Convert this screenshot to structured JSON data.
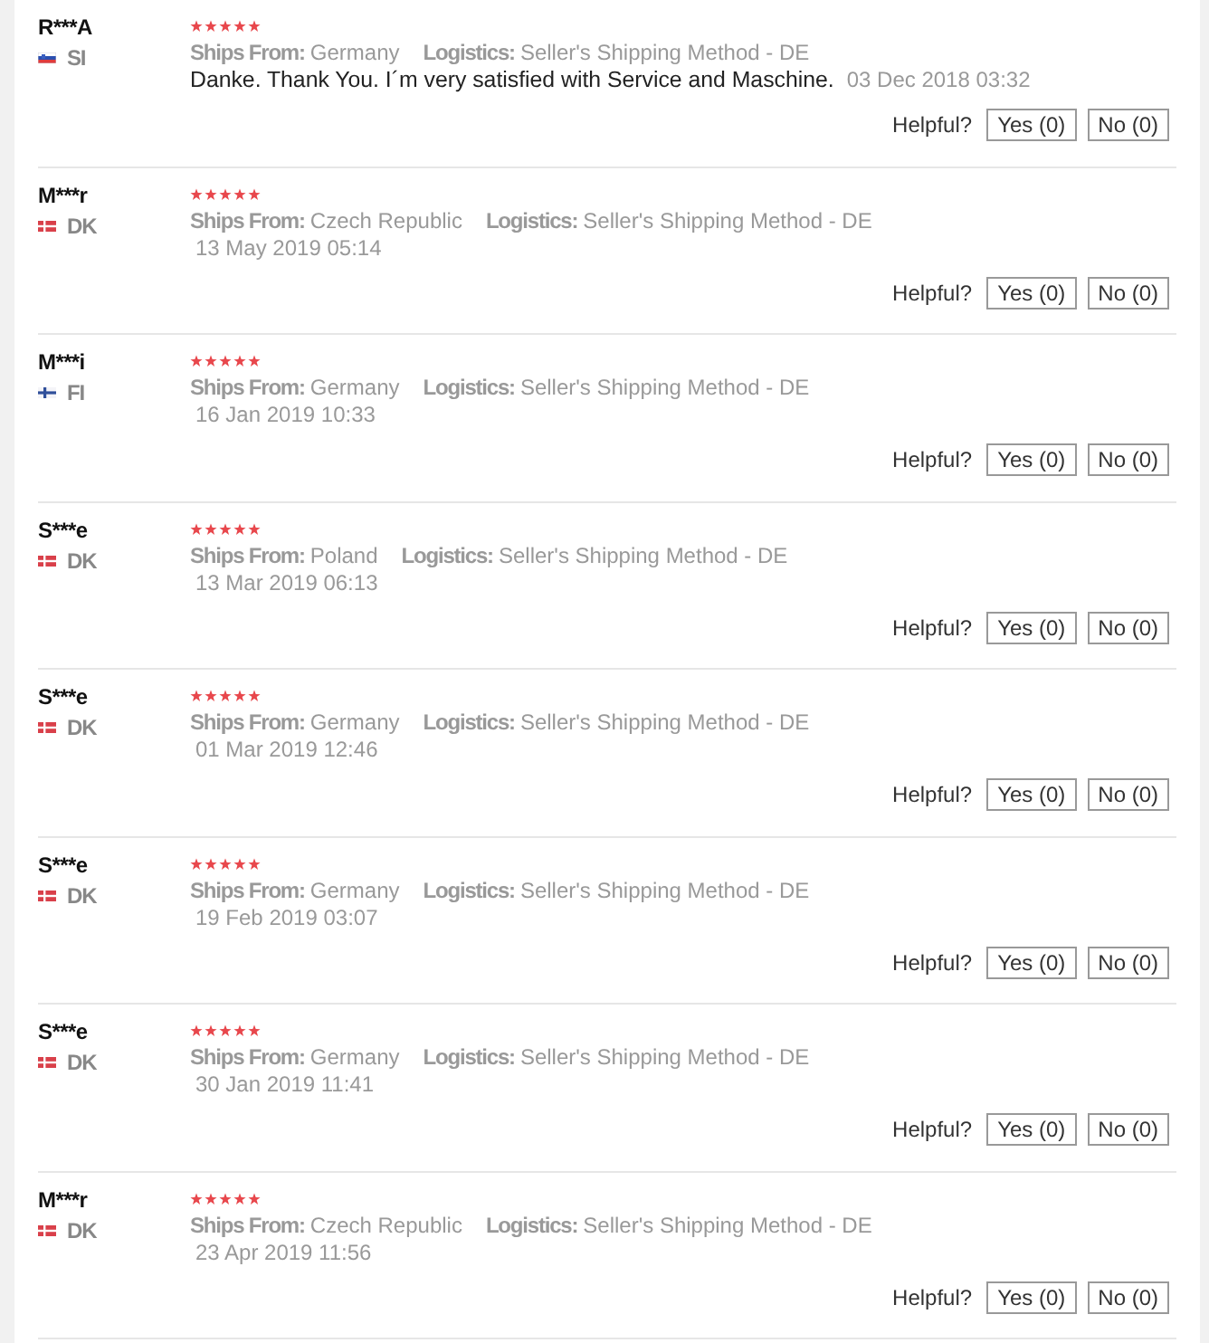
{
  "reviews": [
    {
      "name": "R***A",
      "flag": {
        "kind": "slovenia"
      },
      "country": "SI",
      "stars": 5,
      "ships_from_label": "Ships From:",
      "ships_from": "Germany",
      "logistics_label": "Logistics:",
      "logistics": "Seller's Shipping Method - DE",
      "text": "Danke. Thank You. I´m very satisfied with Service and Maschine.",
      "date": "03 Dec 2018 03:32",
      "helpful_label": "Helpful?",
      "yes_button": "Yes (0)",
      "no_button": "No (0)"
    },
    {
      "name": "M***r",
      "flag": {
        "kind": "denmark"
      },
      "country": "DK",
      "stars": 5,
      "ships_from_label": "Ships From:",
      "ships_from": "Czech Republic",
      "logistics_label": "Logistics:",
      "logistics": "Seller's Shipping Method - DE",
      "date": "13 May 2019 05:14",
      "helpful_label": "Helpful?",
      "yes_button": "Yes (0)",
      "no_button": "No (0)"
    },
    {
      "name": "M***i",
      "flag": {
        "kind": "finland"
      },
      "country": "FI",
      "stars": 5,
      "ships_from_label": "Ships From:",
      "ships_from": "Germany",
      "logistics_label": "Logistics:",
      "logistics": "Seller's Shipping Method - DE",
      "date": "16 Jan 2019 10:33",
      "helpful_label": "Helpful?",
      "yes_button": "Yes (0)",
      "no_button": "No (0)"
    },
    {
      "name": "S***e",
      "flag": {
        "kind": "denmark"
      },
      "country": "DK",
      "stars": 5,
      "ships_from_label": "Ships From:",
      "ships_from": "Poland",
      "logistics_label": "Logistics:",
      "logistics": "Seller's Shipping Method - DE",
      "date": "13 Mar 2019 06:13",
      "helpful_label": "Helpful?",
      "yes_button": "Yes (0)",
      "no_button": "No (0)"
    },
    {
      "name": "S***e",
      "flag": {
        "kind": "denmark"
      },
      "country": "DK",
      "stars": 5,
      "ships_from_label": "Ships From:",
      "ships_from": "Germany",
      "logistics_label": "Logistics:",
      "logistics": "Seller's Shipping Method - DE",
      "date": "01 Mar 2019 12:46",
      "helpful_label": "Helpful?",
      "yes_button": "Yes (0)",
      "no_button": "No (0)"
    },
    {
      "name": "S***e",
      "flag": {
        "kind": "denmark"
      },
      "country": "DK",
      "stars": 5,
      "ships_from_label": "Ships From:",
      "ships_from": "Germany",
      "logistics_label": "Logistics:",
      "logistics": "Seller's Shipping Method - DE",
      "date": "19 Feb 2019 03:07",
      "helpful_label": "Helpful?",
      "yes_button": "Yes (0)",
      "no_button": "No (0)"
    },
    {
      "name": "S***e",
      "flag": {
        "kind": "denmark"
      },
      "country": "DK",
      "stars": 5,
      "ships_from_label": "Ships From:",
      "ships_from": "Germany",
      "logistics_label": "Logistics:",
      "logistics": "Seller's Shipping Method - DE",
      "date": "30 Jan 2019 11:41",
      "helpful_label": "Helpful?",
      "yes_button": "Yes (0)",
      "no_button": "No (0)"
    },
    {
      "name": "M***r",
      "flag": {
        "kind": "denmark"
      },
      "country": "DK",
      "stars": 5,
      "ships_from_label": "Ships From:",
      "ships_from": "Czech Republic",
      "logistics_label": "Logistics:",
      "logistics": "Seller's Shipping Method - DE",
      "date": "23 Apr 2019 11:56",
      "helpful_label": "Helpful?",
      "yes_button": "Yes (0)",
      "no_button": "No (0)"
    }
  ]
}
